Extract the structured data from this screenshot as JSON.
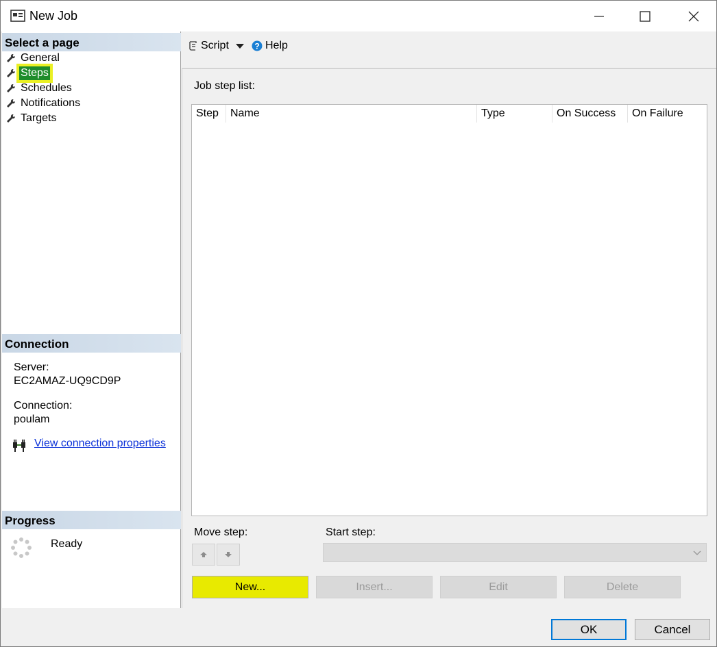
{
  "window": {
    "title": "New Job",
    "icons": {
      "app": "window-icon",
      "minimize": "minimize-icon",
      "maximize": "maximize-icon",
      "close": "close-icon"
    }
  },
  "left_pane": {
    "select_page_header": "Select a page",
    "pages": [
      {
        "label": "General",
        "selected": false
      },
      {
        "label": "Steps",
        "selected": true
      },
      {
        "label": "Schedules",
        "selected": false
      },
      {
        "label": "Notifications",
        "selected": false
      },
      {
        "label": "Targets",
        "selected": false
      }
    ],
    "connection_header": "Connection",
    "server_label": "Server:",
    "server_value": "EC2AMAZ-UQ9CD9P",
    "connection_label": "Connection:",
    "connection_value": "poulam",
    "view_connection_link": "View connection properties",
    "progress_header": "Progress",
    "progress_status": "Ready"
  },
  "toolbar": {
    "script_label": "Script",
    "help_label": "Help"
  },
  "steps_page": {
    "job_step_list_label": "Job step list:",
    "columns": [
      "Step",
      "Name",
      "Type",
      "On Success",
      "On Failure"
    ],
    "rows": [],
    "move_step_label": "Move step:",
    "start_step_label": "Start step:",
    "start_step_value": "",
    "buttons": {
      "new": "New...",
      "insert": "Insert...",
      "edit": "Edit",
      "delete": "Delete"
    }
  },
  "dialog_buttons": {
    "ok": "OK",
    "cancel": "Cancel"
  },
  "colors": {
    "selected_bg": "#1e8c2b",
    "highlight": "#eaf024",
    "link": "#0b31d8",
    "section_header": "#c9d7e6"
  }
}
